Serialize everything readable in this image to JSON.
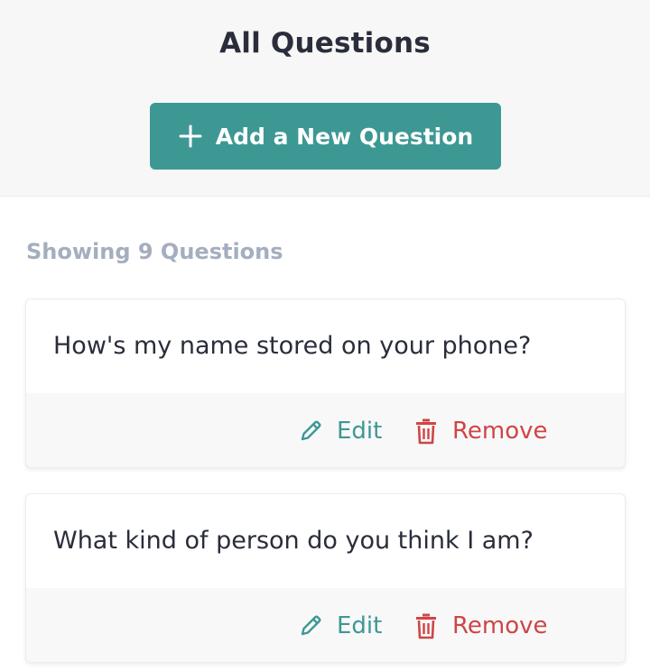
{
  "header": {
    "title": "All Questions",
    "add_button_label": "Add a New Question"
  },
  "list": {
    "count_label": "Showing 9 Questions",
    "questions": [
      {
        "text": "How's my name stored on your phone?",
        "edit_label": "Edit",
        "remove_label": "Remove"
      },
      {
        "text": "What kind of person do you think I am?",
        "edit_label": "Edit",
        "remove_label": "Remove"
      }
    ]
  },
  "colors": {
    "accent": "#3d9894",
    "danger": "#d04545",
    "muted": "#a4aebf"
  },
  "icons": [
    "plus-icon",
    "pencil-icon",
    "trash-icon"
  ]
}
